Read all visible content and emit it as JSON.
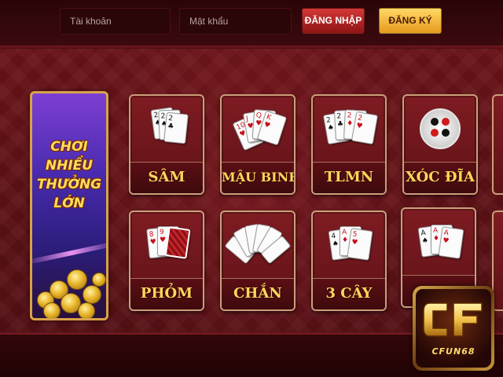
{
  "login": {
    "username_placeholder": "Tài khoản",
    "password_placeholder": "Mật khẩu",
    "login_label": "ĐĂNG NHẬP",
    "register_label": "ĐĂNG KÝ"
  },
  "promo": {
    "line1": "CHƠI NHIỀU",
    "line2": "THƯỞNG LỚN"
  },
  "games": [
    {
      "label": "SÂM",
      "icon": "playing-cards-icon"
    },
    {
      "label": "MẬU BINH",
      "icon": "face-cards-fan-icon"
    },
    {
      "label": "TLMN",
      "icon": "playing-cards-icon"
    },
    {
      "label": "XÓC ĐĨA",
      "icon": "xoc-dia-bowl-icon"
    },
    {
      "label": "PHỎM",
      "icon": "playing-cards-icon"
    },
    {
      "label": "CHẮN",
      "icon": "card-fan-icon"
    },
    {
      "label": "3 CÂY",
      "icon": "playing-cards-icon"
    },
    {
      "label": "",
      "icon": "ace-cards-icon"
    }
  ],
  "logo": {
    "text": "CFUN68"
  },
  "colors": {
    "accent_gold": "#ffd75a",
    "login_red": "#d43838",
    "register_orange": "#f0b02a",
    "background_red": "#5f1217"
  }
}
